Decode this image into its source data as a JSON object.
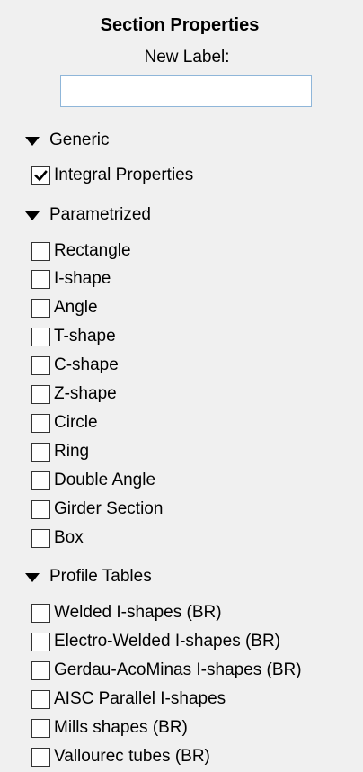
{
  "panel": {
    "title": "Section Properties",
    "new_label_caption": "New Label:",
    "new_label_value": "",
    "new_label_placeholder": ""
  },
  "sections": {
    "generic": {
      "header": "Generic",
      "expanded": true,
      "items": [
        {
          "label": "Integral Properties",
          "checked": true
        }
      ]
    },
    "parametrized": {
      "header": "Parametrized",
      "expanded": true,
      "items": [
        {
          "label": "Rectangle",
          "checked": false
        },
        {
          "label": "I-shape",
          "checked": false
        },
        {
          "label": "Angle",
          "checked": false
        },
        {
          "label": "T-shape",
          "checked": false
        },
        {
          "label": "C-shape",
          "checked": false
        },
        {
          "label": "Z-shape",
          "checked": false
        },
        {
          "label": "Circle",
          "checked": false
        },
        {
          "label": "Ring",
          "checked": false
        },
        {
          "label": "Double Angle",
          "checked": false
        },
        {
          "label": "Girder Section",
          "checked": false
        },
        {
          "label": "Box",
          "checked": false
        }
      ]
    },
    "profile_tables": {
      "header": "Profile Tables",
      "expanded": true,
      "items": [
        {
          "label": "Welded I-shapes (BR)",
          "checked": false
        },
        {
          "label": "Electro-Welded I-shapes (BR)",
          "checked": false
        },
        {
          "label": "Gerdau-AcoMinas I-shapes (BR)",
          "checked": false
        },
        {
          "label": "AISC Parallel I-shapes",
          "checked": false
        },
        {
          "label": "Mills shapes (BR)",
          "checked": false
        },
        {
          "label": "Vallourec tubes (BR)",
          "checked": false
        }
      ]
    }
  },
  "icons": {
    "expanded_indicator": "triangle-down-icon",
    "check_mark": "check-icon"
  },
  "colors": {
    "background": "#f0f0f0",
    "input_border": "#8fb6d9"
  }
}
